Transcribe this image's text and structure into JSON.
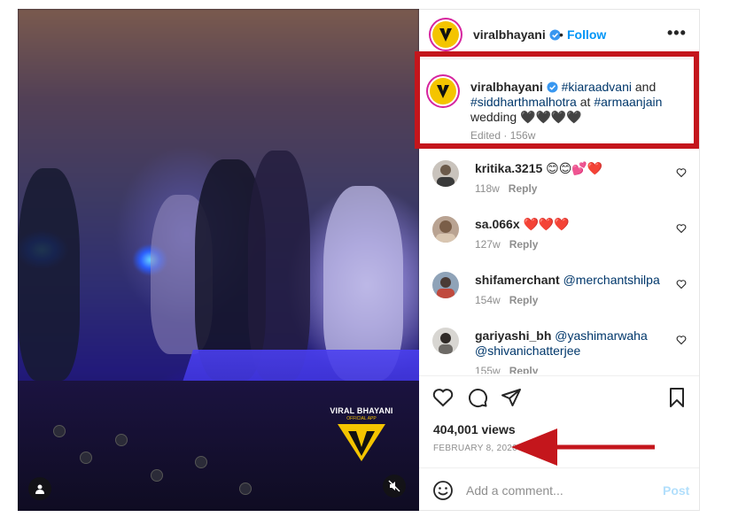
{
  "media": {
    "brand_name": "VIRAL BHAYANI",
    "brand_subtitle": "OFFICIAL APP"
  },
  "post": {
    "username": "viralbhayani",
    "follow_label": "Follow",
    "separator": "•",
    "more_label": "•••"
  },
  "caption": {
    "username": "viralbhayani",
    "tag_1": "#kiaraadvani",
    "text_1": " and ",
    "tag_2": "#siddharthmalhotra",
    "text_2": " at ",
    "tag_3": "#armaanjain",
    "text_3": " wedding ",
    "hearts": "🖤🖤🖤🖤",
    "meta": "Edited · 156w"
  },
  "comments": [
    {
      "username": "kritika.3215",
      "text": " 😊😊💕❤️",
      "age": "118w",
      "reply": "Reply"
    },
    {
      "username": "sa.066x",
      "text": " ❤️❤️❤️",
      "age": "127w",
      "reply": "Reply"
    },
    {
      "username": "shifamerchant",
      "text": " ",
      "mention": "@merchantshilpa",
      "age": "154w",
      "reply": "Reply"
    },
    {
      "username": "gariyashi_bh",
      "text": " ",
      "mention": "@yashimarwaha",
      "mention_2": "@shivanichatterjee",
      "age": "155w",
      "reply": "Reply"
    }
  ],
  "stats": {
    "views": "404,001 views",
    "date": "FEBRUARY 8, 2020"
  },
  "add_comment": {
    "placeholder": "Add a comment...",
    "post_label": "Post"
  },
  "colors": {
    "annotation_red": "#c4161c",
    "link_blue": "#0095f6",
    "hashtag": "#00376b",
    "brand_yellow": "#f4c400"
  }
}
